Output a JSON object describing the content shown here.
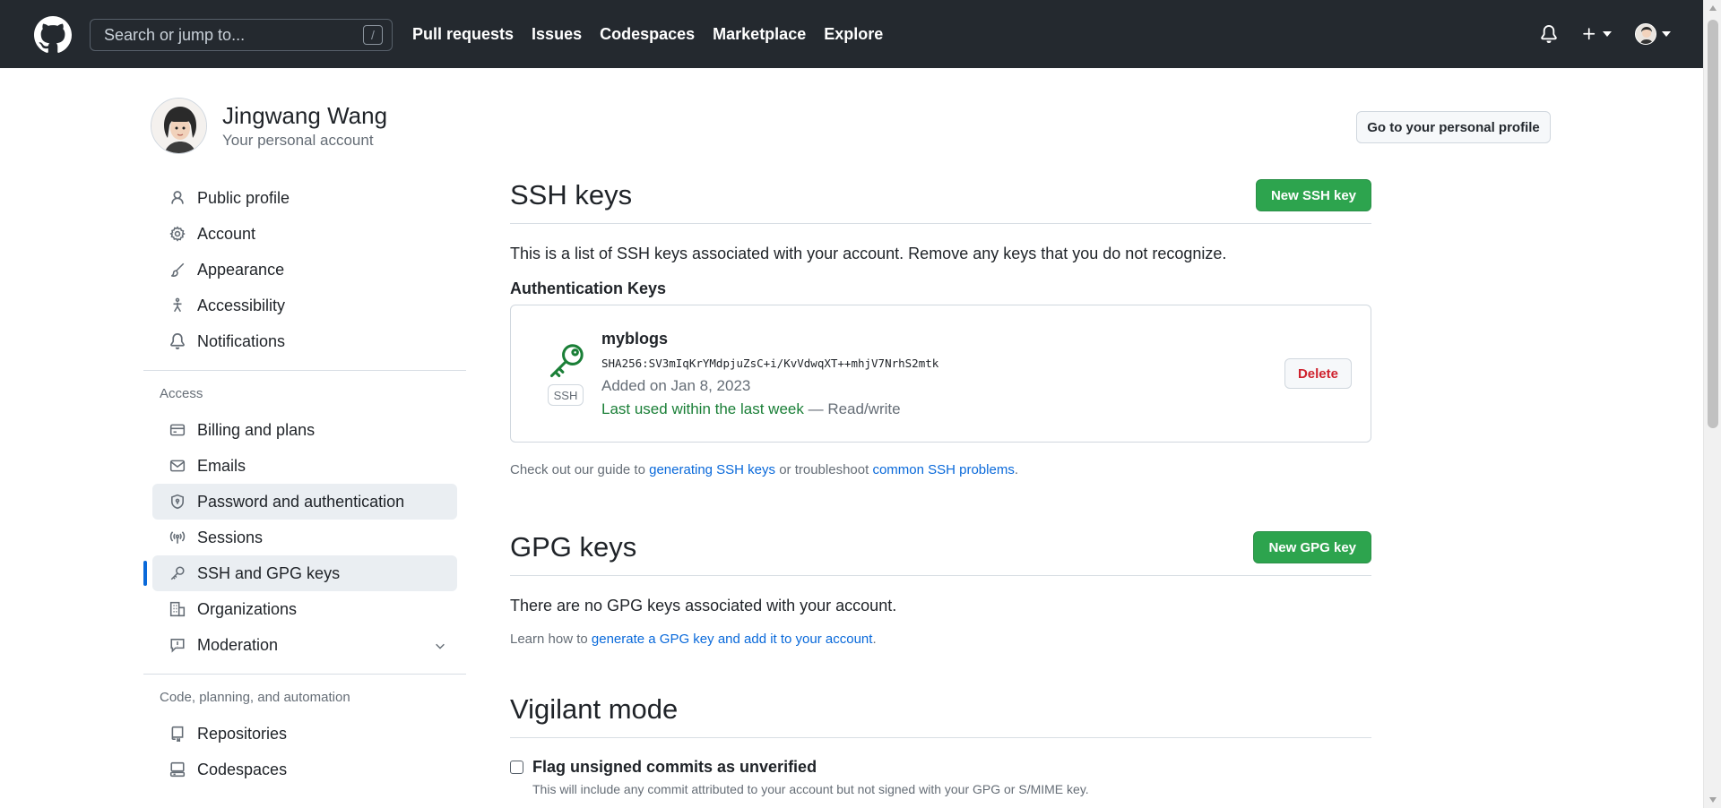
{
  "header": {
    "search_placeholder": "Search or jump to...",
    "search_shortcut": "/",
    "nav": [
      "Pull requests",
      "Issues",
      "Codespaces",
      "Marketplace",
      "Explore"
    ]
  },
  "account": {
    "name": "Jingwang Wang",
    "subtitle": "Your personal account",
    "profile_button": "Go to your personal profile"
  },
  "sidebar": {
    "top_items": [
      {
        "label": "Public profile",
        "icon": "person-icon"
      },
      {
        "label": "Account",
        "icon": "gear-icon"
      },
      {
        "label": "Appearance",
        "icon": "paintbrush-icon"
      },
      {
        "label": "Accessibility",
        "icon": "accessibility-icon"
      },
      {
        "label": "Notifications",
        "icon": "bell-icon"
      }
    ],
    "access_label": "Access",
    "access_items": [
      {
        "label": "Billing and plans",
        "icon": "credit-card-icon"
      },
      {
        "label": "Emails",
        "icon": "mail-icon"
      },
      {
        "label": "Password and authentication",
        "icon": "shield-lock-icon"
      },
      {
        "label": "Sessions",
        "icon": "broadcast-icon"
      },
      {
        "label": "SSH and GPG keys",
        "icon": "key-icon"
      },
      {
        "label": "Organizations",
        "icon": "organization-icon"
      },
      {
        "label": "Moderation",
        "icon": "report-icon"
      }
    ],
    "code_label": "Code, planning, and automation",
    "code_items": [
      {
        "label": "Repositories",
        "icon": "repo-icon"
      },
      {
        "label": "Codespaces",
        "icon": "codespaces-icon"
      }
    ]
  },
  "ssh": {
    "title": "SSH keys",
    "new_button": "New SSH key",
    "description": "This is a list of SSH keys associated with your account. Remove any keys that you do not recognize.",
    "auth_heading": "Authentication Keys",
    "key": {
      "title": "myblogs",
      "badge": "SSH",
      "fingerprint": "SHA256:SV3mIqKrYMdpjuZsC+i/KvVdwqXT++mhjV7NrhS2mtk",
      "added": "Added on Jan 8, 2023",
      "last_used": "Last used within the last week",
      "access": "— Read/write",
      "delete_button": "Delete"
    },
    "guide_prefix": "Check out our guide to ",
    "guide_link1": "generating SSH keys",
    "guide_middle": " or troubleshoot ",
    "guide_link2": "common SSH problems",
    "guide_suffix": "."
  },
  "gpg": {
    "title": "GPG keys",
    "new_button": "New GPG key",
    "empty_text": "There are no GPG keys associated with your account.",
    "learn_prefix": "Learn how to ",
    "learn_link": "generate a GPG key and add it to your account",
    "learn_suffix": "."
  },
  "vigilant": {
    "title": "Vigilant mode",
    "checkbox_label": "Flag unsigned commits as unverified",
    "checkbox_checked": false,
    "checkbox_help": "This will include any commit attributed to your account but not signed with your GPG or S/MIME key."
  },
  "colors": {
    "header_bg": "#24292f",
    "primary_green": "#2da44e",
    "link_blue": "#0969da",
    "danger_red": "#cf222e",
    "success_green": "#1a7f37"
  }
}
